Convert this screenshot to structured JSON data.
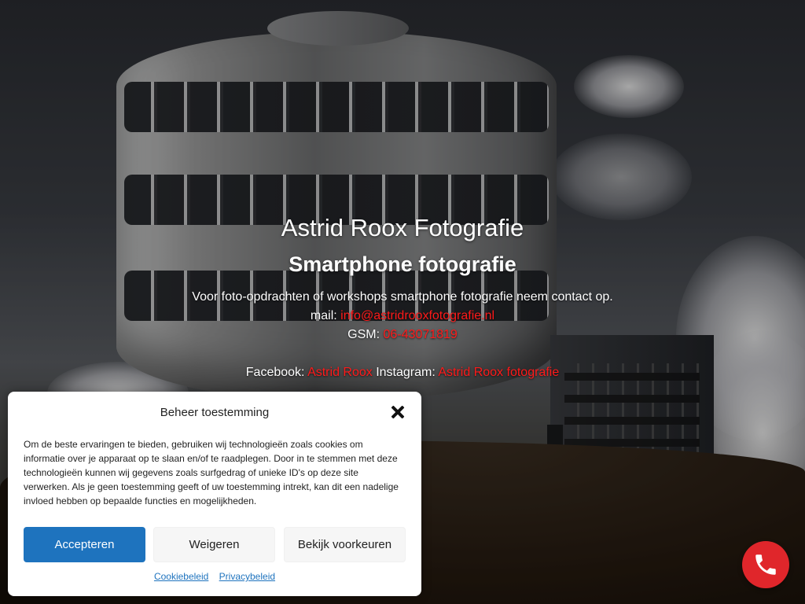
{
  "hero": {
    "title": "Astrid Roox Fotografie",
    "subtitle": "Smartphone fotografie",
    "intro": "Voor foto-opdrachten of workshops smartphone fotografie neem contact op.",
    "mail_label": "mail: ",
    "mail_value": "info@astridrooxfotografie.nl",
    "gsm_label": "GSM: ",
    "gsm_value": "06-43071819",
    "facebook_label": "Facebook: ",
    "facebook_value": "Astrid Roox",
    "instagram_label": " Instagram: ",
    "instagram_value": "Astrid Roox fotografie",
    "link_color": "#ff1a1a"
  },
  "cookie_dialog": {
    "title": "Beheer toestemming",
    "body": "Om de beste ervaringen te bieden, gebruiken wij technologieën zoals cookies om informatie over je apparaat op te slaan en/of te raadplegen. Door in te stemmen met deze technologieën kunnen wij gegevens zoals surfgedrag of unieke ID's op deze site verwerken. Als je geen toestemming geeft of uw toestemming intrekt, kan dit een nadelige invloed hebben op bepaalde functies en mogelijkheden.",
    "accept_label": "Accepteren",
    "deny_label": "Weigeren",
    "preferences_label": "Bekijk voorkeuren",
    "cookie_policy_link": "Cookiebeleid",
    "privacy_policy_link": "Privacybeleid",
    "accent_color": "#1e73be"
  },
  "floating": {
    "phone_icon": "phone-icon",
    "phone_color": "#e0262b"
  }
}
